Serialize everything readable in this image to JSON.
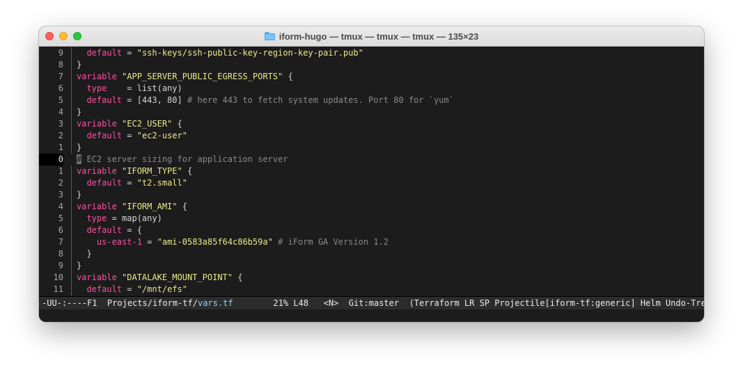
{
  "window": {
    "title": "iform-hugo — tmux — tmux — tmux — 135×23",
    "title_icon": "folder-icon"
  },
  "editor": {
    "lines": [
      {
        "n": "9",
        "guide": true,
        "current": false,
        "parts": [
          [
            "t",
            "  "
          ],
          [
            "attr",
            "default"
          ],
          [
            "t",
            " = "
          ],
          [
            "str",
            "\"ssh-keys/ssh-public-key-region-key-pair.pub\""
          ]
        ]
      },
      {
        "n": "8",
        "guide": true,
        "current": false,
        "parts": [
          [
            "t",
            "}"
          ]
        ]
      },
      {
        "n": "7",
        "guide": true,
        "current": false,
        "parts": [
          [
            "kw",
            "variable"
          ],
          [
            "t",
            " "
          ],
          [
            "str",
            "\"APP_SERVER_PUBLIC_EGRESS_PORTS\""
          ],
          [
            "t",
            " {"
          ]
        ]
      },
      {
        "n": "6",
        "guide": true,
        "current": false,
        "parts": [
          [
            "t",
            "  "
          ],
          [
            "attr",
            "type"
          ],
          [
            "t",
            "    = list(any)"
          ]
        ]
      },
      {
        "n": "5",
        "guide": true,
        "current": false,
        "parts": [
          [
            "t",
            "  "
          ],
          [
            "attr",
            "default"
          ],
          [
            "t",
            " = [443, 80] "
          ],
          [
            "cmt",
            "# here 443 to fetch system updates. Port 80 for `yum`"
          ]
        ]
      },
      {
        "n": "4",
        "guide": true,
        "current": false,
        "parts": [
          [
            "t",
            "}"
          ]
        ]
      },
      {
        "n": "3",
        "guide": true,
        "current": false,
        "parts": [
          [
            "kw",
            "variable"
          ],
          [
            "t",
            " "
          ],
          [
            "str",
            "\"EC2_USER\""
          ],
          [
            "t",
            " {"
          ]
        ]
      },
      {
        "n": "2",
        "guide": true,
        "current": false,
        "parts": [
          [
            "t",
            "  "
          ],
          [
            "attr",
            "default"
          ],
          [
            "t",
            " = "
          ],
          [
            "str",
            "\"ec2-user\""
          ]
        ]
      },
      {
        "n": "1",
        "guide": true,
        "current": false,
        "parts": [
          [
            "t",
            "}"
          ]
        ]
      },
      {
        "n": "0",
        "guide": false,
        "current": true,
        "parts": [
          [
            "cursor",
            "#"
          ],
          [
            "cmt",
            " EC2 server sizing for application server"
          ]
        ]
      },
      {
        "n": "1",
        "guide": true,
        "current": false,
        "parts": [
          [
            "kw",
            "variable"
          ],
          [
            "t",
            " "
          ],
          [
            "str",
            "\"IFORM_TYPE\""
          ],
          [
            "t",
            " {"
          ]
        ]
      },
      {
        "n": "2",
        "guide": true,
        "current": false,
        "parts": [
          [
            "t",
            "  "
          ],
          [
            "attr",
            "default"
          ],
          [
            "t",
            " = "
          ],
          [
            "str",
            "\"t2.small\""
          ]
        ]
      },
      {
        "n": "3",
        "guide": true,
        "current": false,
        "parts": [
          [
            "t",
            "}"
          ]
        ]
      },
      {
        "n": "4",
        "guide": true,
        "current": false,
        "parts": [
          [
            "kw",
            "variable"
          ],
          [
            "t",
            " "
          ],
          [
            "str",
            "\"IFORM_AMI\""
          ],
          [
            "t",
            " {"
          ]
        ]
      },
      {
        "n": "5",
        "guide": true,
        "current": false,
        "parts": [
          [
            "t",
            "  "
          ],
          [
            "attr",
            "type"
          ],
          [
            "t",
            " = map(any)"
          ]
        ]
      },
      {
        "n": "6",
        "guide": true,
        "current": false,
        "parts": [
          [
            "t",
            "  "
          ],
          [
            "attr",
            "default"
          ],
          [
            "t",
            " = {"
          ]
        ]
      },
      {
        "n": "7",
        "guide": true,
        "current": false,
        "parts": [
          [
            "t",
            "    "
          ],
          [
            "attr",
            "us-east-1"
          ],
          [
            "t",
            " = "
          ],
          [
            "str",
            "\"ami-0583a85f64c86b59a\""
          ],
          [
            "t",
            " "
          ],
          [
            "cmt",
            "# iForm GA Version 1.2"
          ]
        ]
      },
      {
        "n": "8",
        "guide": true,
        "current": false,
        "parts": [
          [
            "t",
            "  }"
          ]
        ]
      },
      {
        "n": "9",
        "guide": true,
        "current": false,
        "parts": [
          [
            "t",
            "}"
          ]
        ]
      },
      {
        "n": "10",
        "guide": true,
        "current": false,
        "parts": [
          [
            "kw",
            "variable"
          ],
          [
            "t",
            " "
          ],
          [
            "str",
            "\"DATALAKE_MOUNT_POINT\""
          ],
          [
            "t",
            " {"
          ]
        ]
      },
      {
        "n": "11",
        "guide": true,
        "current": false,
        "parts": [
          [
            "t",
            "  "
          ],
          [
            "attr",
            "default"
          ],
          [
            "t",
            " = "
          ],
          [
            "str",
            "\"/mnt/efs\""
          ]
        ]
      }
    ]
  },
  "modeline": {
    "status": "-UU-:----F1  ",
    "path_prefix": "Projects/iform-tf/",
    "file_name": "vars.tf",
    "position": "        21% L48   ",
    "state": "<N>",
    "git": "  Git:master  ",
    "modes": "(Terraform LR SP Projectile[iform-tf:generic] Helm Undo-Tree)"
  }
}
